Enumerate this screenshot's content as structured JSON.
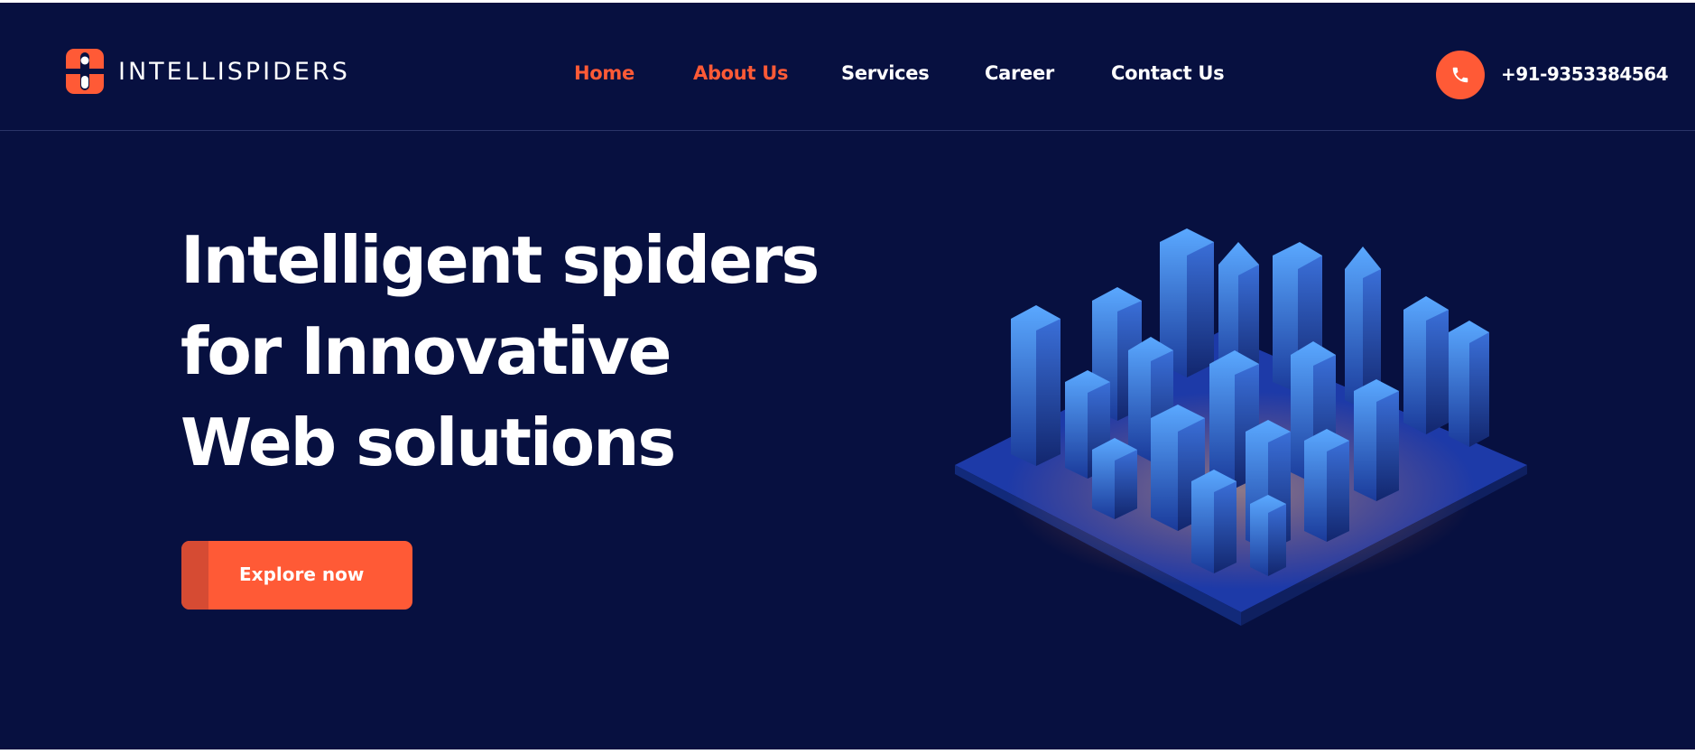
{
  "brand": {
    "name": "INTELLISPIDERS"
  },
  "nav": {
    "items": [
      {
        "label": "Home",
        "active": true
      },
      {
        "label": "About Us",
        "active": true
      },
      {
        "label": "Services",
        "active": false
      },
      {
        "label": "Career",
        "active": false
      },
      {
        "label": "Contact Us",
        "active": false
      }
    ]
  },
  "contact": {
    "phone": "+91-9353384564",
    "icon": "phone-icon"
  },
  "hero": {
    "title_lines": [
      "Intelligent spiders",
      "for Innovative",
      "Web solutions"
    ],
    "cta_label": "Explore now",
    "illustration": "isometric-city-illustration"
  },
  "colors": {
    "background": "#071040",
    "accent": "#ff5a36",
    "text": "#ffffff"
  }
}
